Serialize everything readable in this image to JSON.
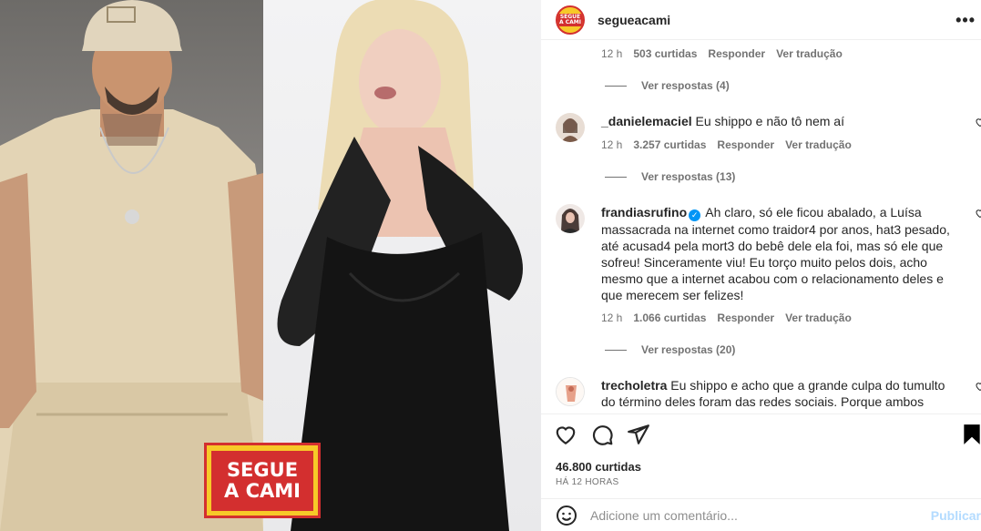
{
  "post": {
    "username": "segueacami",
    "brand_colors": {
      "yellow": "#f7c928",
      "red": "#d32f2f"
    },
    "logo_text": "SEGUE A CAMI",
    "avatar_text": "SEGUE A CAMI",
    "likes": "46.800 curtidas",
    "posted": "HÁ 12 HORAS",
    "more_icon": "more-horizontal-icon"
  },
  "comments": [
    {
      "meta": {
        "time": "12 h",
        "likes": "503 curtidas",
        "reply": "Responder",
        "translate": "Ver tradução"
      },
      "replies": "Ver respostas (4)"
    },
    {
      "user": "_danielemaciel",
      "text": "Eu shippo e não tô nem aí",
      "meta": {
        "time": "12 h",
        "likes": "3.257 curtidas",
        "reply": "Responder",
        "translate": "Ver tradução"
      },
      "replies": "Ver respostas (13)"
    },
    {
      "user": "frandiasrufino",
      "verified": true,
      "text": "Ah claro, só ele ficou abalado, a Luísa massacrada na internet como traidor4 por anos, hat3 pesado, até acusad4 pela mort3 do bebê dele ela foi, mas só ele que sofreu! Sinceramente viu! Eu torço muito pelos dois, acho mesmo que a internet acabou com o relacionamento deles e que merecem ser felizes!",
      "meta": {
        "time": "12 h",
        "likes": "1.066 curtidas",
        "reply": "Responder",
        "translate": "Ver tradução"
      },
      "replies": "Ver respostas (20)"
    },
    {
      "user": "trecholetra",
      "text": "Eu shippo e acho que a grande culpa do tumulto do término deles foram das redes sociais. Porque ambos"
    }
  ],
  "comment_input": {
    "placeholder": "Adicione um comentário...",
    "publish": "Publicar"
  }
}
